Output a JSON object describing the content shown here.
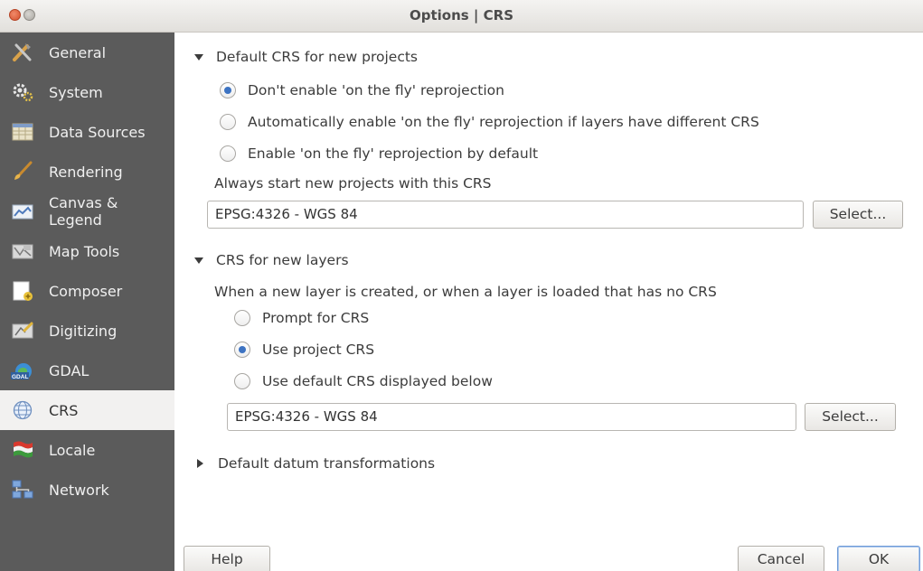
{
  "window": {
    "title": "Options | CRS"
  },
  "sidebar": {
    "items": [
      {
        "label": "General",
        "icon": "tools-icon"
      },
      {
        "label": "System",
        "icon": "gear-icon"
      },
      {
        "label": "Data Sources",
        "icon": "table-icon"
      },
      {
        "label": "Rendering",
        "icon": "brush-icon"
      },
      {
        "label": "Canvas &\nLegend",
        "icon": "canvas-icon"
      },
      {
        "label": "Map Tools",
        "icon": "map-tools-icon"
      },
      {
        "label": "Composer",
        "icon": "composer-icon"
      },
      {
        "label": "Digitizing",
        "icon": "digitizing-icon"
      },
      {
        "label": "GDAL",
        "icon": "gdal-icon"
      },
      {
        "label": "CRS",
        "icon": "globe-icon"
      },
      {
        "label": "Locale",
        "icon": "flag-icon"
      },
      {
        "label": "Network",
        "icon": "network-icon"
      }
    ],
    "selected": "CRS"
  },
  "default_crs": {
    "heading": "Default CRS for new projects",
    "options": [
      {
        "label": "Don't enable 'on the fly' reprojection",
        "checked": true
      },
      {
        "label": "Automatically enable 'on the fly' reprojection if layers have different CRS",
        "checked": false
      },
      {
        "label": "Enable 'on the fly' reprojection by default",
        "checked": false
      }
    ],
    "always_label": "Always start new projects with this CRS",
    "crs_value": "EPSG:4326 - WGS 84",
    "select_label": "Select..."
  },
  "new_layers": {
    "heading": "CRS for new layers",
    "description": "When a new layer is created, or when a layer is loaded that has no CRS",
    "options": [
      {
        "label": "Prompt for CRS",
        "checked": false
      },
      {
        "label": "Use project CRS",
        "checked": true
      },
      {
        "label": "Use default CRS displayed below",
        "checked": false
      }
    ],
    "crs_value": "EPSG:4326 - WGS 84",
    "select_label": "Select..."
  },
  "datum": {
    "heading": "Default datum transformations"
  },
  "footer": {
    "help_label": "Help",
    "cancel_label": "Cancel",
    "ok_label": "OK"
  }
}
